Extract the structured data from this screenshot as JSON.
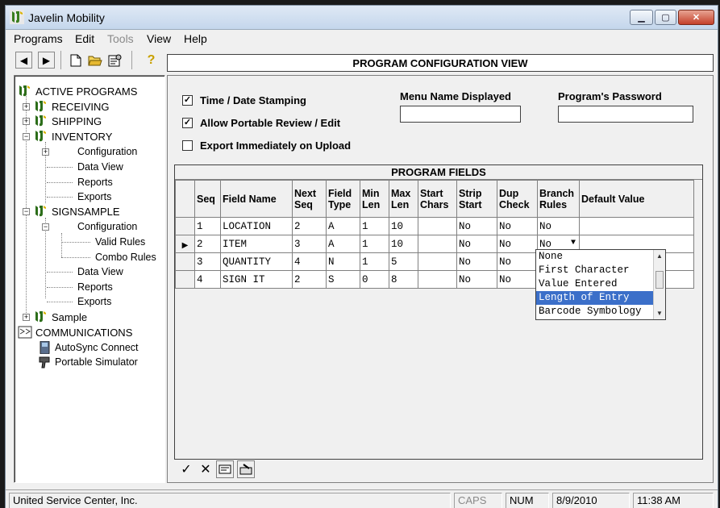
{
  "window": {
    "title": "Javelin Mobility"
  },
  "menu": [
    {
      "label": "Programs",
      "enabled": true
    },
    {
      "label": "Edit",
      "enabled": true
    },
    {
      "label": "Tools",
      "enabled": false
    },
    {
      "label": "View",
      "enabled": true
    },
    {
      "label": "Help",
      "enabled": true
    }
  ],
  "toolbar": {
    "icons": [
      "arrow-left-icon",
      "arrow-right-icon",
      "new-document-icon",
      "open-folder-icon",
      "properties-icon",
      "help-icon"
    ]
  },
  "tree": {
    "root": "ACTIVE PROGRAMS",
    "receiving": "RECEIVING",
    "shipping": "SHIPPING",
    "inventory": "INVENTORY",
    "inv_configuration": "Configuration",
    "inv_data_view": "Data View",
    "inv_reports": "Reports",
    "inv_exports": "Exports",
    "signsample": "SIGNSAMPLE",
    "sig_configuration": "Configuration",
    "sig_valid_rules": "Valid Rules",
    "sig_combo_rules": "Combo Rules",
    "sig_data_view": "Data View",
    "sig_reports": "Reports",
    "sig_exports": "Exports",
    "sample": "Sample",
    "communications": "COMMUNICATIONS",
    "autosync": "AutoSync Connect",
    "simulator": "Portable Simulator"
  },
  "view_header": "PROGRAM CONFIGURATION VIEW",
  "options": {
    "time_date": {
      "label": "Time / Date Stamping",
      "checked": true
    },
    "portable_review": {
      "label": "Allow Portable Review / Edit",
      "checked": true
    },
    "export_upload": {
      "label": "Export Immediately on Upload",
      "checked": false
    }
  },
  "menu_name": {
    "label": "Menu Name Displayed",
    "value": ""
  },
  "password": {
    "label": "Program's Password",
    "value": ""
  },
  "grid": {
    "title": "PROGRAM FIELDS",
    "columns": [
      "Seq",
      "Field Name",
      "Next Seq",
      "Field Type",
      "Min Len",
      "Max Len",
      "Start Chars",
      "Strip Start",
      "Dup Check",
      "Branch Rules",
      "Default Value"
    ],
    "rows": [
      [
        "1",
        "LOCATION",
        "2",
        "A",
        "1",
        "10",
        "",
        "No",
        "No",
        "No",
        ""
      ],
      [
        "2",
        "ITEM",
        "3",
        "A",
        "1",
        "10",
        "",
        "No",
        "No",
        "No",
        ""
      ],
      [
        "3",
        "QUANTITY",
        "4",
        "N",
        "1",
        "5",
        "",
        "No",
        "No",
        "",
        ""
      ],
      [
        "4",
        "SIGN IT",
        "2",
        "S",
        "0",
        "8",
        "",
        "No",
        "No",
        "",
        ""
      ]
    ],
    "current_row": 1
  },
  "branch_dropdown": {
    "options": [
      "None",
      "First Character",
      "Value Entered",
      "Length of Entry",
      "Barcode Symbology"
    ],
    "selected": 3
  },
  "bottom_tools": [
    "checkmark-icon",
    "x-icon",
    "edit-field-icon",
    "delete-field-icon"
  ],
  "status": {
    "company": "United Service Center, Inc.",
    "caps": "CAPS",
    "num": "NUM",
    "date": "8/9/2010",
    "time": "11:38 AM"
  }
}
